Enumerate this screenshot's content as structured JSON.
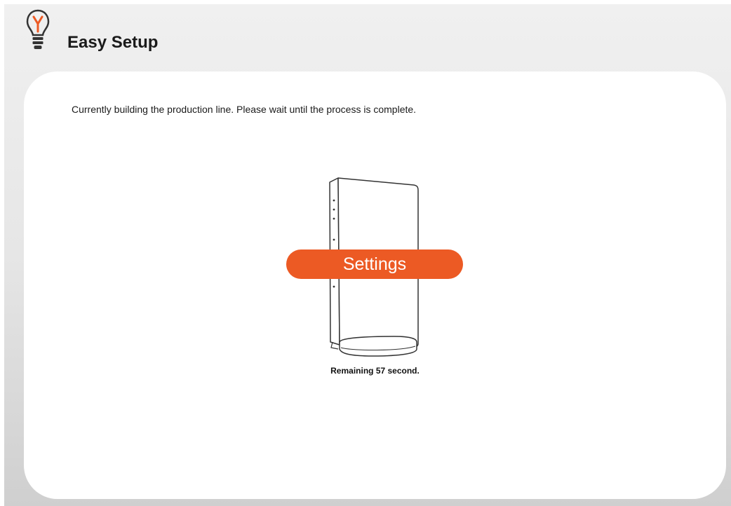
{
  "header": {
    "title": "Easy Setup",
    "icon": "lightbulb-icon"
  },
  "main": {
    "message": "Currently building the production line. Please wait until the process is complete.",
    "device_illustration": "router-icon",
    "settings_label": "Settings",
    "remaining": "Remaining 57 second."
  },
  "colors": {
    "accent": "#ec5a24",
    "card_bg": "#ffffff",
    "page_bg": "#e6e6e6"
  }
}
